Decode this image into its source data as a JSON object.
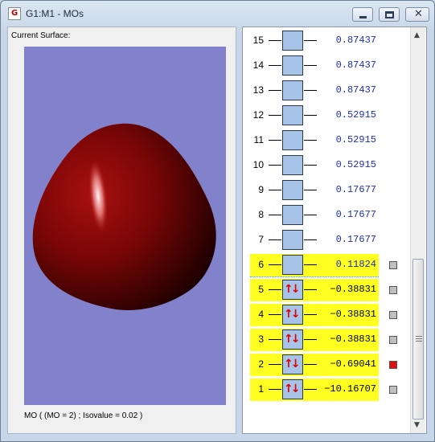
{
  "window": {
    "title": "G1:M1 - MOs"
  },
  "surface": {
    "label": "Current Surface:",
    "status": "MO ( (MO = 2) ; Isovalue = 0.02 )",
    "background": "#8282cc",
    "surface_color": "#8b0000"
  },
  "orbitals": [
    {
      "n": "15",
      "energy": "0.87437",
      "occ": false,
      "checked": false,
      "visible_check": false
    },
    {
      "n": "14",
      "energy": "0.87437",
      "occ": false,
      "checked": false,
      "visible_check": false
    },
    {
      "n": "13",
      "energy": "0.87437",
      "occ": false,
      "checked": false,
      "visible_check": false
    },
    {
      "n": "12",
      "energy": "0.52915",
      "occ": false,
      "checked": false,
      "visible_check": false
    },
    {
      "n": "11",
      "energy": "0.52915",
      "occ": false,
      "checked": false,
      "visible_check": false
    },
    {
      "n": "10",
      "energy": "0.52915",
      "occ": false,
      "checked": false,
      "visible_check": false
    },
    {
      "n": "9",
      "energy": "0.17677",
      "occ": false,
      "checked": false,
      "visible_check": false
    },
    {
      "n": "8",
      "energy": "0.17677",
      "occ": false,
      "checked": false,
      "visible_check": false
    },
    {
      "n": "7",
      "energy": "0.17677",
      "occ": false,
      "checked": false,
      "visible_check": false
    },
    {
      "n": "6",
      "energy": "0.11824",
      "occ": false,
      "checked": false,
      "visible_check": true,
      "highlight": true
    },
    {
      "n": "5",
      "energy": "−0.38831",
      "occ": true,
      "checked": false,
      "visible_check": true,
      "highlight": true
    },
    {
      "n": "4",
      "energy": "−0.38831",
      "occ": true,
      "checked": false,
      "visible_check": true,
      "highlight": true
    },
    {
      "n": "3",
      "energy": "−0.38831",
      "occ": true,
      "checked": false,
      "visible_check": true,
      "highlight": true
    },
    {
      "n": "2",
      "energy": "−0.69041",
      "occ": true,
      "checked": true,
      "visible_check": true,
      "highlight": true
    },
    {
      "n": "1",
      "energy": "−10.16707",
      "occ": true,
      "checked": false,
      "visible_check": true,
      "highlight": true
    }
  ],
  "occupancy_glyph": "↑↓",
  "scrollbar": {
    "up_glyph": "▲",
    "down_glyph": "▼"
  },
  "controls": {
    "close_glyph": "✕"
  }
}
